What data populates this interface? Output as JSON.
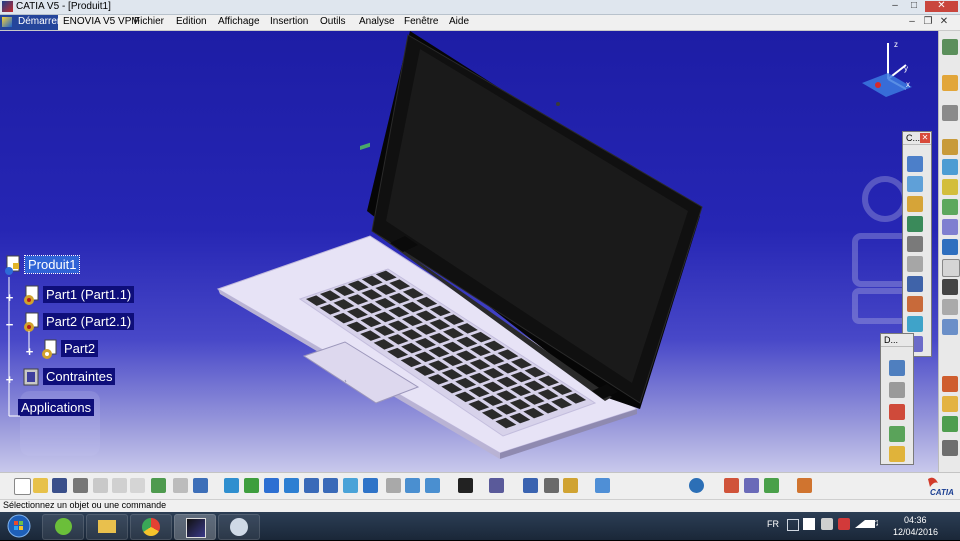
{
  "window": {
    "title": "CATIA V5 - [Produit1]"
  },
  "menu": {
    "start_label": "Démarrer",
    "items": [
      "ENOVIA V5 VPM",
      "Fichier",
      "Edition",
      "Affichage",
      "Insertion",
      "Outils",
      "Analyse",
      "Fenêtre",
      "Aide"
    ]
  },
  "tree": {
    "root": "Produit1",
    "part1": "Part1 (Part1.1)",
    "part2": "Part2 (Part2.1)",
    "part2_child": "Part2",
    "constraints": "Contraintes",
    "applications": "Applications"
  },
  "compass": {
    "axis_x": "x",
    "axis_y": "y",
    "axis_z": "z"
  },
  "palettes": {
    "constraints_title": "C...",
    "dmu_title": "D..."
  },
  "status": {
    "message": "Sélectionnez un objet ou une commande"
  },
  "taskbar": {
    "language": "FR",
    "time": "04:36",
    "date": "12/04/2016"
  },
  "brand": {
    "logo_text": "CATIA"
  },
  "colors": {
    "viewport_top": "#1d1da5",
    "viewport_bottom": "#c8c8ec",
    "tree_selected": "#2f63d6",
    "laptop_base": "#e7e3f6",
    "laptop_screen": "#141414"
  }
}
